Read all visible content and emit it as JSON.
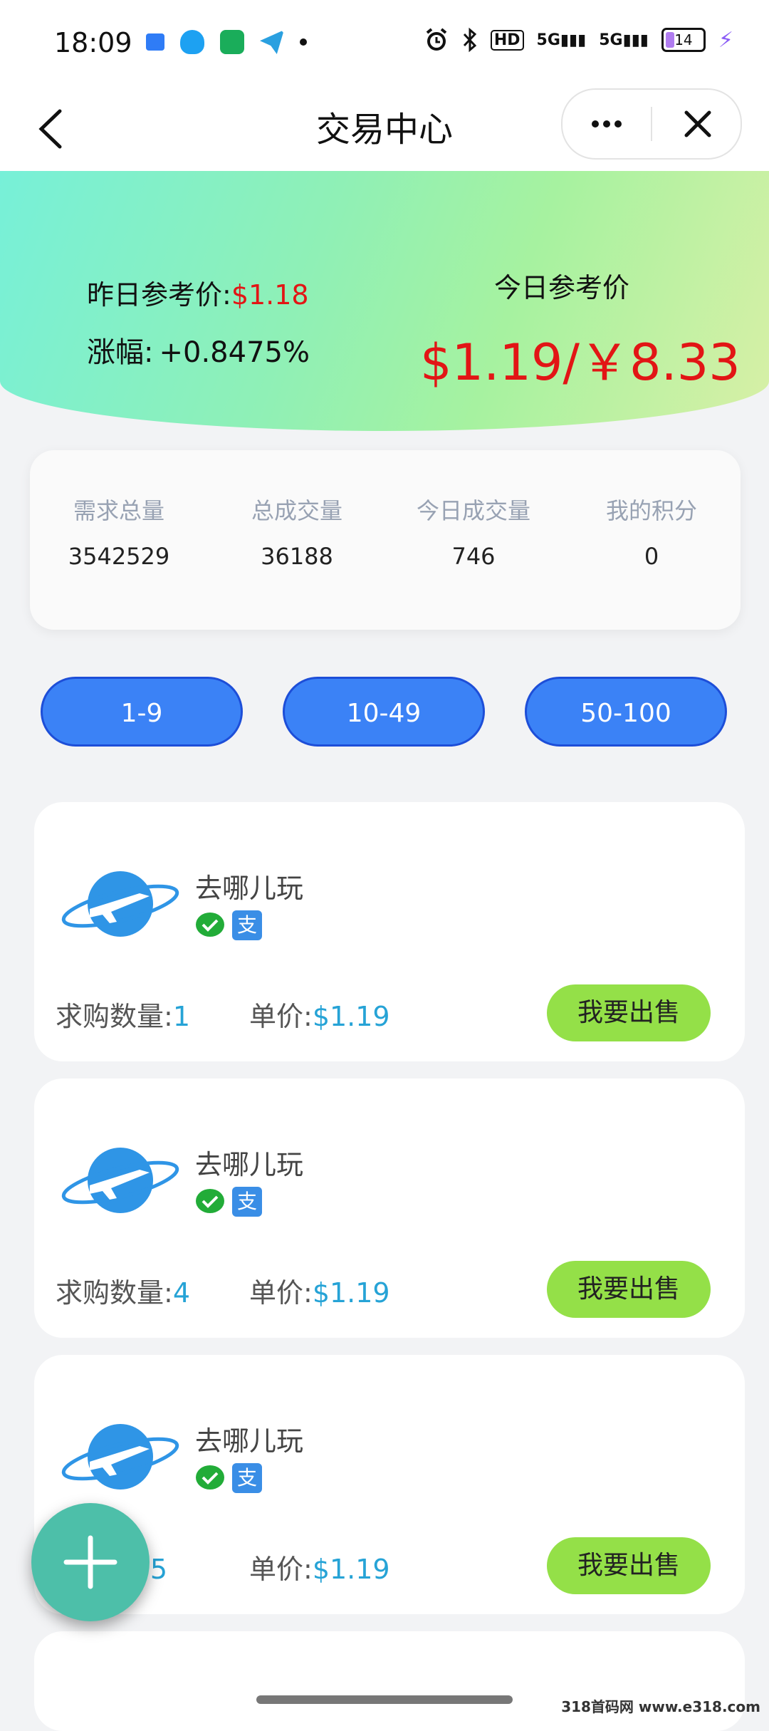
{
  "status_bar": {
    "time": "18:09",
    "hd_label": "HD",
    "net1": "5G",
    "net2": "5G",
    "battery": "14"
  },
  "nav": {
    "title": "交易中心"
  },
  "hero": {
    "yesterday_label": "昨日参考价:",
    "yesterday_value": "$1.18",
    "change_label": "涨幅:",
    "change_value": "+0.8475%",
    "today_label": "今日参考价",
    "today_value": "$1.19/￥8.33"
  },
  "stats": [
    {
      "label": "需求总量",
      "value": "3542529"
    },
    {
      "label": "总成交量",
      "value": "36188"
    },
    {
      "label": "今日成交量",
      "value": "746"
    },
    {
      "label": "我的积分",
      "value": "0"
    }
  ],
  "filters": [
    "1-9",
    "10-49",
    "50-100"
  ],
  "list": {
    "qty_label": "求购数量:",
    "qty_label_partial": "量:",
    "price_label": "单价:",
    "alipay_glyph": "支",
    "sell_label": "我要出售",
    "items": [
      {
        "name": "去哪儿玩",
        "qty": "1",
        "price": "$1.19"
      },
      {
        "name": "去哪儿玩",
        "qty": "4",
        "price": "$1.19"
      },
      {
        "name": "去哪儿玩",
        "qty": "5",
        "price": "$1.19"
      }
    ]
  },
  "watermark": "318首码网 www.e318.com",
  "colors": {
    "accent_blue": "#3b82f6",
    "price_red": "#e21515",
    "sell_green": "#94e048",
    "fab": "#4dbfa9"
  }
}
